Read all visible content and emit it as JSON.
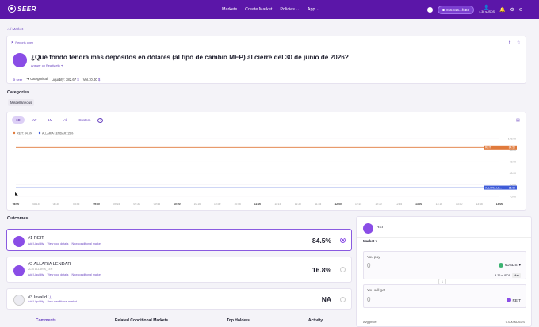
{
  "nav": {
    "logo": "SEER",
    "links": [
      "Markets",
      "Create Market",
      "Policies",
      "App"
    ],
    "wallet": "0x5C16...f6B9",
    "balance": "4.36 sUSDS"
  },
  "breadcrumb": {
    "current": "Market"
  },
  "market": {
    "badge": "Reports open",
    "title": "¿Qué fondo tendrá más depósitos en dólares (al tipo de cambio MEP) al cierre del 30 de junio de 2026?",
    "answer_link": "Answer on Reality.eth",
    "type": "Categorical",
    "liquidity_label": "Liquidity:",
    "liquidity": "382.67",
    "vol_label": "Vol.:",
    "vol": "0.00",
    "currency_icon": "$"
  },
  "categories": {
    "label": "Categories",
    "items": [
      "Miscellaneous"
    ]
  },
  "chart_controls": {
    "ranges": [
      "1D",
      "1W",
      "1M",
      "All",
      "Custom"
    ],
    "active": "1D"
  },
  "chart_data": {
    "type": "line",
    "legend": [
      "REIT: 84.5%",
      "ALLARIA LENDAR: 15%"
    ],
    "x": [
      "08:00",
      "08:15",
      "08:30",
      "08:45",
      "09:00",
      "09:15",
      "09:30",
      "09:45",
      "10:00",
      "10:15",
      "10:30",
      "10:45",
      "11:00",
      "11:15",
      "11:30",
      "11:45",
      "12:00",
      "12:15",
      "12:30",
      "12:45",
      "13:00",
      "13:15",
      "13:30",
      "13:45",
      "14:00"
    ],
    "series": [
      {
        "name": "REIT",
        "end_label": "84.50",
        "color": "#e07a3c",
        "values": [
          84.5,
          84.5,
          84.5,
          84.5,
          84.5,
          84.5,
          84.5,
          84.5,
          84.5,
          84.5,
          84.5,
          84.5,
          84.5,
          84.5,
          84.5,
          84.5,
          84.5,
          84.5,
          84.5,
          84.5,
          84.5,
          84.5,
          84.5,
          84.5,
          84.5
        ]
      },
      {
        "name": "ALLARIA LE...",
        "end_label": "15.00",
        "color": "#3e5bd8",
        "values": [
          15,
          15,
          15,
          15,
          15,
          15,
          15,
          15,
          15,
          15,
          15,
          15,
          15,
          15,
          15,
          15,
          15,
          15,
          15,
          15,
          15,
          15,
          15,
          15,
          15
        ]
      }
    ],
    "y_ticks": [
      100,
      80,
      60,
      40,
      20,
      0
    ],
    "y_tick_labels": [
      "100.00",
      "80.00",
      "60.00",
      "40.00",
      "20.00",
      "0.00"
    ],
    "ylim": [
      0,
      100
    ],
    "grid": true,
    "legend_position": "top-left"
  },
  "outcomes": {
    "label": "Outcomes",
    "items": [
      {
        "name": "#1 REIT",
        "sub": "",
        "pct": "84.5%",
        "links": [
          "Add Liquidity",
          "View pool details",
          "New conditional market"
        ]
      },
      {
        "name": "#2 ALLARIA LENDAR",
        "sub": "2C30 ALLARIA_LEN",
        "pct": "16.8%",
        "links": [
          "Add Liquidity",
          "View pool details",
          "New conditional market"
        ]
      },
      {
        "name": "#3 Invalid",
        "sub": "",
        "pct": "NA",
        "links": [
          "Add Liquidity",
          "New conditional market"
        ]
      }
    ]
  },
  "tabs": [
    "Comments",
    "Related Conditional Markets",
    "Top Holders",
    "Activity"
  ],
  "trade": {
    "outcome": "REIT",
    "type": "Market",
    "you_pay": "You pay",
    "pay_value": "0",
    "pay_token": "sUSDS",
    "pay_balance": "4.36 sUSDS",
    "max": "Max",
    "you_get": "You will get",
    "get_value": "0",
    "get_token": "REIT",
    "avg_price_label": "Avg price",
    "avg_price": "0.000 sUSDS"
  }
}
